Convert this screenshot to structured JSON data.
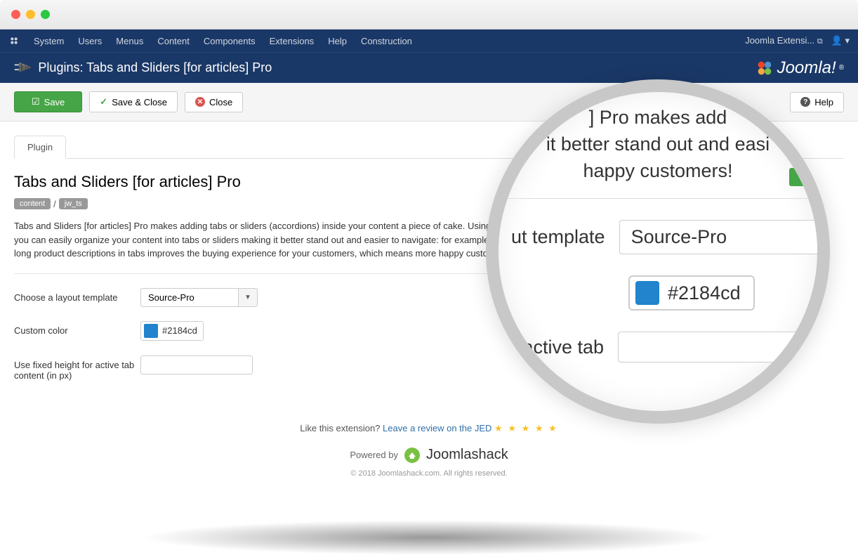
{
  "topmenu": {
    "items": [
      "System",
      "Users",
      "Menus",
      "Content",
      "Components",
      "Extensions",
      "Help",
      "Construction"
    ],
    "right_label": "Joomla Extensi..."
  },
  "header": {
    "title": "Plugins: Tabs and Sliders [for articles] Pro",
    "brand": "Joomla!"
  },
  "toolbar": {
    "save": "Save",
    "save_close": "Save & Close",
    "close": "Close",
    "help": "Help"
  },
  "tabs": {
    "plugin": "Plugin"
  },
  "plugin": {
    "title": "Tabs and Sliders [for articles] Pro",
    "badge_content": "content",
    "badge_name": "jw_ts",
    "description": "Tabs and Sliders [for articles] Pro makes adding tabs or sliders (accordions) inside your content a piece of cake. Using a simple syntax you can easily organize your content into tabs or sliders making it better stand out and easier to navigate: for example, organizing your long product descriptions in tabs improves the buying experience for your customers, which means more happy customers!"
  },
  "form": {
    "template_label": "Choose a layout template",
    "template_value": "Source-Pro",
    "color_label": "Custom color",
    "color_value": "#2184cd",
    "color_hex": "#2184cd",
    "height_label": "Use fixed height for active tab content (in px)"
  },
  "footer": {
    "like_text": "Like this extension?",
    "review_link": "Leave a review on the JED",
    "powered_by": "Powered by",
    "shack": "Joomlashack",
    "copyright": "© 2018 Joomlashack.com. All rights reserved."
  },
  "magnifier": {
    "top_line1": "] Pro makes add",
    "top_line2": "it better stand out and easi",
    "top_line3": "happy customers!",
    "template_partial": "ut template",
    "template_value": "Source-Pro",
    "color_value": "#2184cd",
    "color_hex": "#2184cd",
    "height_partial": "r active tab"
  }
}
